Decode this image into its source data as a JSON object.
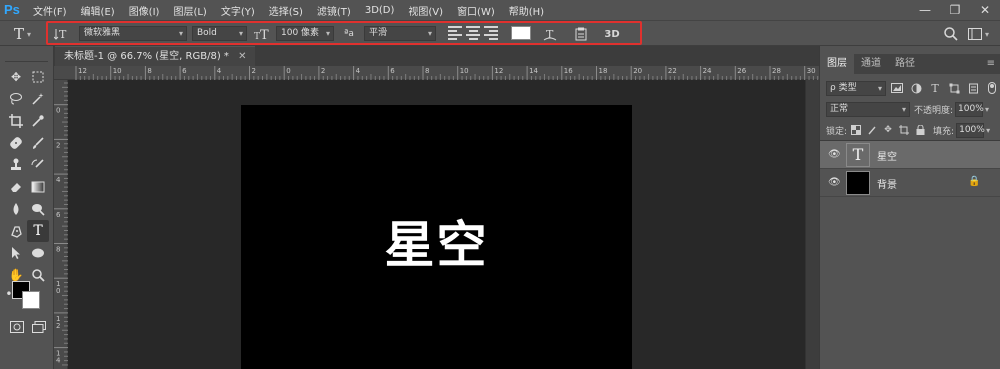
{
  "app": {
    "logo": "Ps"
  },
  "menu": [
    "文件(F)",
    "编辑(E)",
    "图像(I)",
    "图层(L)",
    "文字(Y)",
    "选择(S)",
    "滤镜(T)",
    "3D(D)",
    "视图(V)",
    "窗口(W)",
    "帮助(H)"
  ],
  "window_controls": {
    "minimize": "—",
    "restore": "❐",
    "close": "✕"
  },
  "options_bar": {
    "tool_icon": "T",
    "font_family": "微软雅黑",
    "font_style": "Bold",
    "font_size": "100 像素",
    "aa_label": "ªa",
    "antialias": "平滑",
    "text_color": "#ffffff",
    "three_d_label": "3D",
    "highlight_color": "#e0312e"
  },
  "document": {
    "tab_title": "未标题-1 @ 66.7% (星空, RGB/8) *",
    "canvas_text": "星空",
    "canvas_background": "#000000"
  },
  "ruler": {
    "h_labels": [
      "12",
      "10",
      "8",
      "6",
      "4",
      "2",
      "0",
      "2",
      "4",
      "6",
      "8",
      "10",
      "12",
      "14",
      "16",
      "18",
      "20",
      "22",
      "24",
      "26",
      "28",
      "30"
    ],
    "v_labels": [
      "2",
      "0",
      "2",
      "4",
      "6",
      "8",
      "10",
      "12",
      "14",
      "16"
    ]
  },
  "layers_panel": {
    "tabs": [
      "图层",
      "通道",
      "路径"
    ],
    "filter_label": "ρ 类型",
    "blend_mode": "正常",
    "opacity_label": "不透明度:",
    "opacity_value": "100%",
    "lock_label": "锁定:",
    "fill_label": "填充:",
    "fill_value": "100%",
    "layers": [
      {
        "name": "星空",
        "type": "text",
        "selected": true
      },
      {
        "name": "背景",
        "type": "background",
        "locked": true
      }
    ]
  },
  "colors": {
    "foreground": "#000000",
    "background": "#ffffff"
  }
}
